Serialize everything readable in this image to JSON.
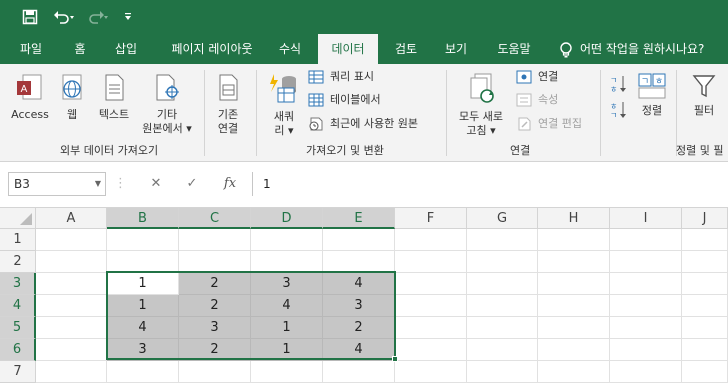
{
  "qat": {
    "save_icon": "save-icon",
    "undo_icon": "undo-icon",
    "redo_icon": "redo-icon",
    "customize_icon": "customize-qat-icon"
  },
  "tabs": [
    "파일",
    "홈",
    "삽입",
    "페이지 레이아웃",
    "수식",
    "데이터",
    "검토",
    "보기",
    "도움말"
  ],
  "active_tab": "데이터",
  "tell_me": "어떤 작업을 원하시나요?",
  "ribbon": {
    "group_external": {
      "access": "Access",
      "web": "웹",
      "text": "텍스트",
      "other_line1": "기타",
      "other_line2": "원본에서 ▾",
      "existing_line1": "기존",
      "existing_line2": "연결",
      "label": "외부 데이터 가져오기"
    },
    "group_transform": {
      "new_query_line1": "새쿼",
      "new_query_line2": "리 ▾",
      "show_queries": "쿼리 표시",
      "from_table": "테이블에서",
      "recent_sources": "최근에 사용한 원본",
      "label": "가져오기 및 변환"
    },
    "group_connections": {
      "refresh_line1": "모두 새로",
      "refresh_line2": "고침 ▾",
      "connections": "연결",
      "properties": "속성",
      "edit_links": "연결 편집",
      "label": "연결"
    },
    "group_sort": {
      "sort": "정렬",
      "filter": "필터",
      "label": "정렬 및 필"
    }
  },
  "formula_bar": {
    "name_box": "B3",
    "cancel": "✕",
    "enter": "✓",
    "fx": "fx",
    "value": "1"
  },
  "columns": [
    "A",
    "B",
    "C",
    "D",
    "E",
    "F",
    "G",
    "H",
    "I",
    "J"
  ],
  "selected_columns": [
    "B",
    "C",
    "D",
    "E"
  ],
  "rows": [
    "1",
    "2",
    "3",
    "4",
    "5",
    "6",
    "7"
  ],
  "selected_rows": [
    "3",
    "4",
    "5",
    "6"
  ],
  "cells": {
    "B3": "1",
    "C3": "2",
    "D3": "3",
    "E3": "4",
    "B4": "1",
    "C4": "2",
    "D4": "4",
    "E4": "3",
    "B5": "4",
    "C5": "3",
    "D5": "1",
    "E5": "2",
    "B6": "3",
    "C6": "2",
    "D6": "1",
    "E6": "4"
  },
  "colors": {
    "accent": "#217346",
    "selection_fill": "#c6c6c6"
  }
}
